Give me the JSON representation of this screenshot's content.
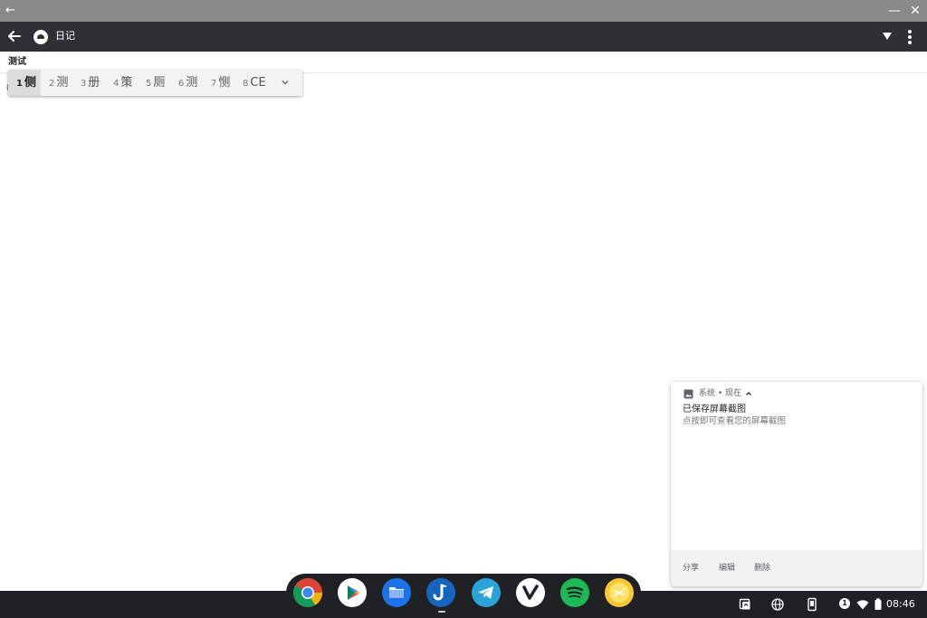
{
  "app": {
    "title": "日记",
    "entry_title": "测试",
    "cursor_char": "("
  },
  "window": {
    "back_glyph": "←",
    "minimize_glyph": "—",
    "close_glyph": "✕"
  },
  "ime": {
    "candidates": [
      {
        "num": "1",
        "text": "侧"
      },
      {
        "num": "2",
        "text": "测"
      },
      {
        "num": "3",
        "text": "册"
      },
      {
        "num": "4",
        "text": "策"
      },
      {
        "num": "5",
        "text": "厕"
      },
      {
        "num": "6",
        "text": "测"
      },
      {
        "num": "7",
        "text": "恻"
      },
      {
        "num": "8",
        "text": "CE"
      }
    ]
  },
  "notification": {
    "header": "系统 • 现在",
    "title": "已保存屏幕截图",
    "body": "点按即可查看您的屏幕截图",
    "actions": [
      "分享",
      "编辑",
      "删除"
    ]
  },
  "shelf": {
    "apps": [
      "chrome-icon",
      "play-store-icon",
      "files-icon",
      "jota-icon",
      "telegram-icon",
      "vivaldi-icon",
      "spotify-icon",
      "lemon-icon"
    ],
    "notification_count": "1",
    "time": "08:46"
  },
  "colors": {
    "titlebar": "#8a8a8a",
    "appbar": "#2d3135",
    "shelf": "#202124"
  }
}
